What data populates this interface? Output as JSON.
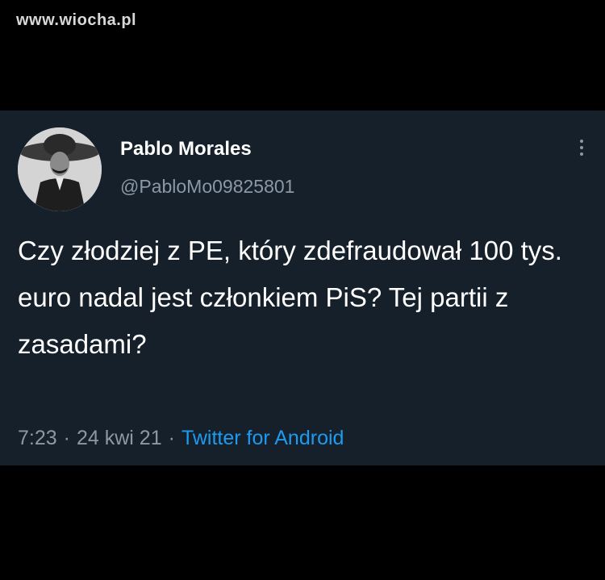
{
  "watermark": "www.wiocha.pl",
  "tweet": {
    "display_name": "Pablo Morales",
    "handle": "@PabloMo09825801",
    "text": "Czy złodziej z PE, który zdefraudował 100 tys. euro nadal jest członkiem PiS? Tej partii z zasadami?",
    "time": "7:23",
    "date": "24 kwi 21",
    "separator": "·",
    "source": "Twitter for Android"
  },
  "icons": {
    "more": "more-vertical-icon"
  },
  "colors": {
    "background": "#000000",
    "tweet_background": "#15202b",
    "text_primary": "#ffffff",
    "text_secondary": "#8b98a5",
    "link": "#1d9bf0"
  }
}
